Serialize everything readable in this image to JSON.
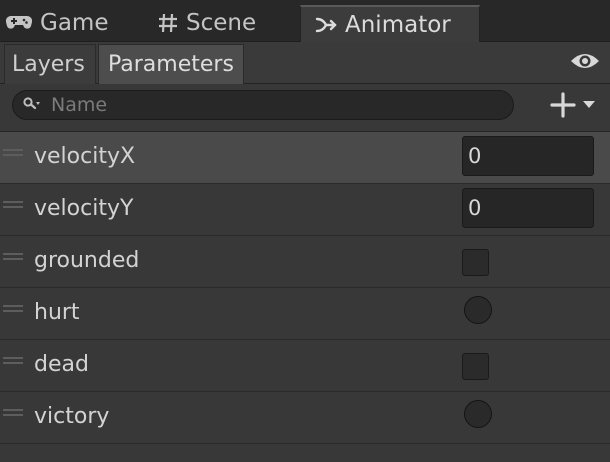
{
  "tabs": {
    "game": {
      "label": "Game",
      "icon": "gamepad-icon"
    },
    "scene": {
      "label": "Scene",
      "icon": "hash-icon"
    },
    "animator": {
      "label": "Animator",
      "icon": "animator-icon"
    }
  },
  "subtabs": {
    "layers": "Layers",
    "parameters": "Parameters"
  },
  "search": {
    "placeholder": "Name",
    "value": ""
  },
  "parameters": [
    {
      "name": "velocityX",
      "type": "float",
      "value": "0",
      "selected": true
    },
    {
      "name": "velocityY",
      "type": "float",
      "value": "0"
    },
    {
      "name": "grounded",
      "type": "bool",
      "value": false
    },
    {
      "name": "hurt",
      "type": "trigger",
      "value": false
    },
    {
      "name": "dead",
      "type": "bool",
      "value": false
    },
    {
      "name": "victory",
      "type": "trigger",
      "value": false
    }
  ],
  "colors": {
    "background": "#383838",
    "tabbar": "#282828",
    "selected_row": "#4a4a4a",
    "field": "#262626",
    "text": "#d3d3d3"
  }
}
